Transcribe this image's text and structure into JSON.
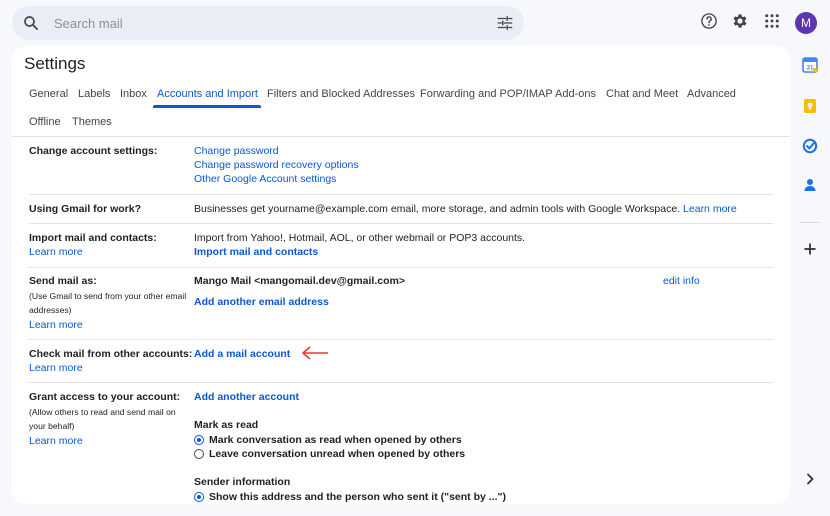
{
  "search": {
    "placeholder": "Search mail"
  },
  "user": {
    "avatar_letter": "M",
    "avatar_color": "#5e35b1"
  },
  "settings": {
    "title": "Settings",
    "tabs": [
      {
        "label": "General"
      },
      {
        "label": "Labels"
      },
      {
        "label": "Inbox"
      },
      {
        "label": "Accounts and Import",
        "active": true
      },
      {
        "label": "Filters and Blocked Addresses"
      },
      {
        "label": "Forwarding and POP/IMAP"
      },
      {
        "label": "Add-ons"
      },
      {
        "label": "Chat and Meet"
      },
      {
        "label": "Advanced"
      },
      {
        "label": "Offline"
      },
      {
        "label": "Themes"
      }
    ],
    "rows": {
      "change_account": {
        "label": "Change account settings:",
        "links": [
          "Change password",
          "Change password recovery options",
          "Other Google Account settings"
        ]
      },
      "work": {
        "label": "Using Gmail for work?",
        "text": "Businesses get yourname@example.com email, more storage, and admin tools with Google Workspace.",
        "link": "Learn more"
      },
      "import": {
        "label": "Import mail and contacts:",
        "learn_more": "Learn more",
        "text": "Import from Yahoo!, Hotmail, AOL, or other webmail or POP3 accounts.",
        "action": "Import mail and contacts"
      },
      "send_as": {
        "label": "Send mail as:",
        "sub": [
          "(Use Gmail to send from your other email",
          "addresses)"
        ],
        "learn_more": "Learn more",
        "account": "Mango Mail <mangomail.dev@gmail.com>",
        "edit": "edit info",
        "action": "Add another email address"
      },
      "check_mail": {
        "label": "Check mail from other accounts:",
        "learn_more": "Learn more",
        "action": "Add a mail account"
      },
      "grant": {
        "label": "Grant access to your account:",
        "sub": [
          "(Allow others to read and send mail on",
          "your behalf)"
        ],
        "learn_more": "Learn more",
        "action": "Add another account",
        "mark_read": {
          "heading": "Mark as read",
          "options": [
            "Mark conversation as read when opened by others",
            "Leave conversation unread when opened by others"
          ],
          "selected": 0
        },
        "sender": {
          "heading": "Sender information",
          "options": [
            "Show this address and the person who sent it (\"sent by ...\")"
          ],
          "selected": 0
        }
      }
    }
  },
  "colors": {
    "accent": "#0b57d0",
    "arrow": "#e53935"
  },
  "side_panel": {
    "icons": [
      "calendar-icon",
      "keep-icon",
      "tasks-icon",
      "contacts-icon",
      "plus-icon",
      "chevron-right-icon"
    ],
    "calendar_day": "31"
  }
}
